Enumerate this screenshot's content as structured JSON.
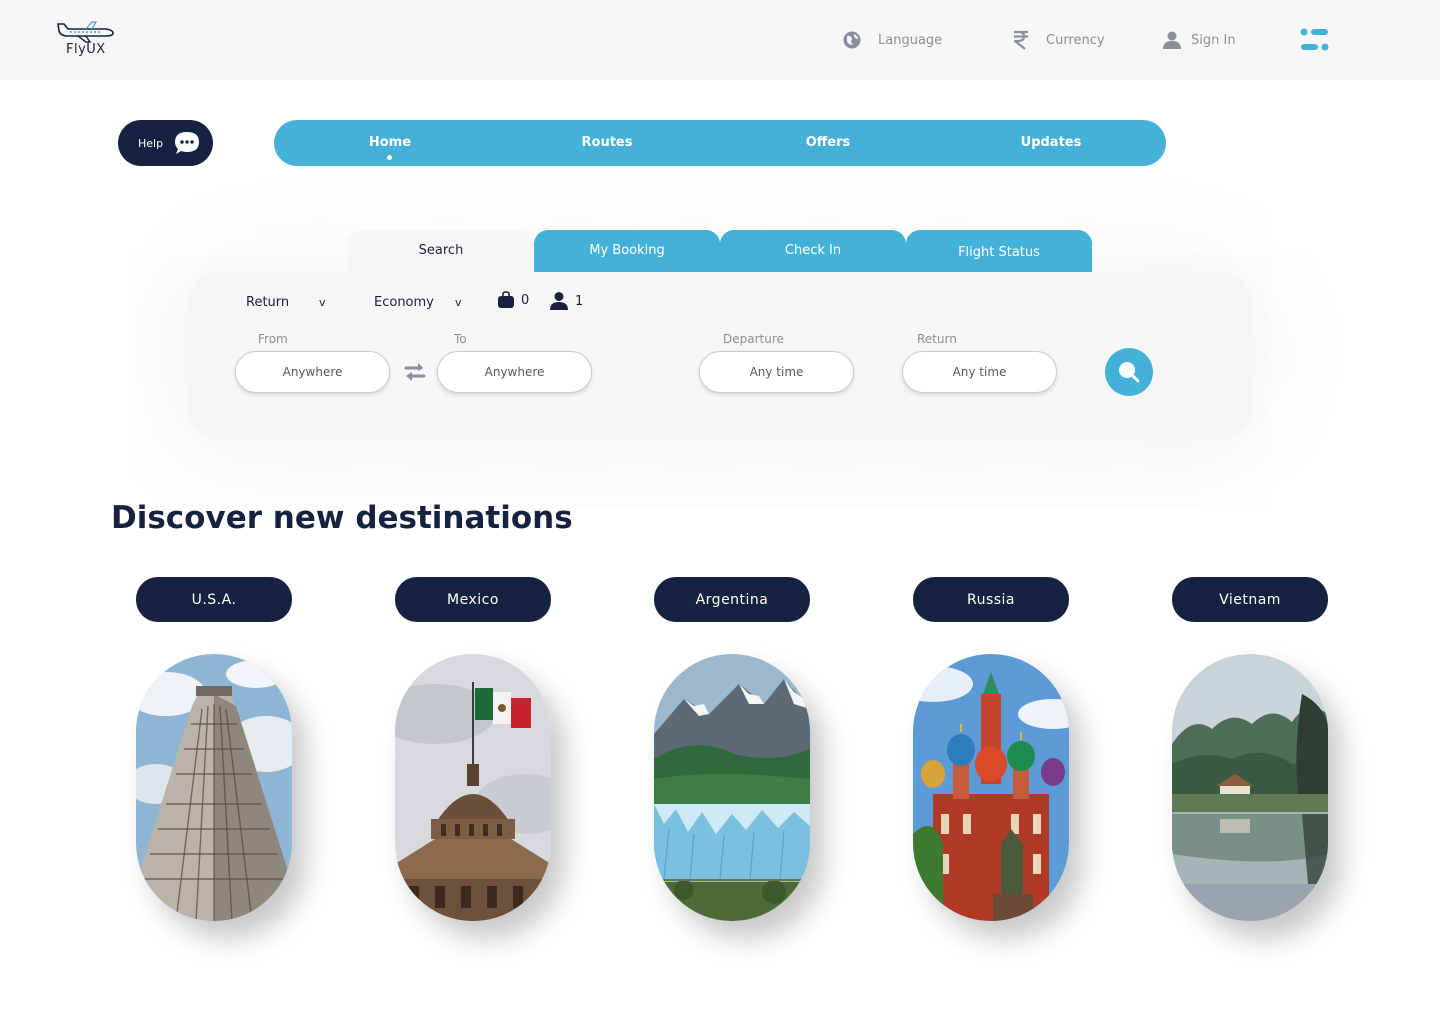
{
  "brand": {
    "name": "FlyUX"
  },
  "header": {
    "language_label": "Language",
    "currency_label": "Currency",
    "signin_label": "Sign In"
  },
  "help": {
    "label": "Help"
  },
  "nav": {
    "items": [
      "Home",
      "Routes",
      "Offers",
      "Updates"
    ],
    "active": "Home"
  },
  "tabs": [
    "Search",
    "My Booking",
    "Check In",
    "Flight Status"
  ],
  "search": {
    "trip_type": "Return",
    "cabin_class": "Economy",
    "bags_count": "0",
    "passengers_count": "1",
    "from_label": "From",
    "from_value": "Anywhere",
    "to_label": "To",
    "to_value": "Anywhere",
    "departure_label": "Departure",
    "departure_value": "Any time",
    "return_label": "Return",
    "return_value": "Any time",
    "chevron": "v"
  },
  "discover": {
    "title": "Discover new destinations",
    "destinations": [
      "U.S.A.",
      "Mexico",
      "Argentina",
      "Russia",
      "Vietnam"
    ]
  },
  "colors": {
    "navy": "#16223f",
    "accent": "#44b2d8",
    "surface": "#f6f6f6"
  }
}
